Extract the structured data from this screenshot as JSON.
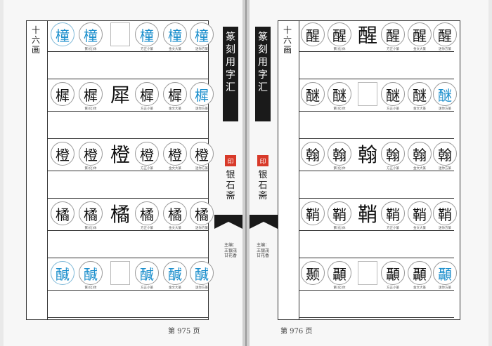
{
  "left_page": {
    "stroke_label": "十六画",
    "page_number": "第 975 页",
    "banner_title": "篆刻用字汇",
    "seal_text": "印",
    "author_name": "银石斋",
    "editor_credit": "主编：王银茂 甘花香",
    "entries": [
      {
        "modern": "橦",
        "traditional": "橦",
        "ancient": "",
        "fangzheng": "橦",
        "jinwen": "橦",
        "miyin": "橦",
        "accent": "blue"
      },
      {
        "modern": "樨",
        "traditional": "樨",
        "ancient": "犀",
        "fangzheng": "樨",
        "jinwen": "樨",
        "miyin": "樨",
        "accent": "mixed"
      },
      {
        "modern": "橙",
        "traditional": "橙",
        "ancient": "橙",
        "fangzheng": "橙",
        "jinwen": "橙",
        "miyin": "橙",
        "accent": "black"
      },
      {
        "modern": "橘",
        "traditional": "橘",
        "ancient": "橘",
        "fangzheng": "橘",
        "jinwen": "橘",
        "miyin": "橘",
        "accent": "black"
      },
      {
        "modern": "醎",
        "traditional": "醎",
        "ancient": "",
        "fangzheng": "醎",
        "jinwen": "醎",
        "miyin": "醎",
        "accent": "blue"
      }
    ]
  },
  "right_page": {
    "stroke_label": "十六画",
    "page_number": "第 976 页",
    "banner_title": "篆刻用字汇",
    "seal_text": "印",
    "author_name": "银石斋",
    "editor_credit": "主编：王银茂 甘花香",
    "entries": [
      {
        "modern": "醒",
        "traditional": "醒",
        "ancient": "醒",
        "fangzheng": "醒",
        "jinwen": "醒",
        "miyin": "醒",
        "accent": "black"
      },
      {
        "modern": "醚",
        "traditional": "醚",
        "ancient": "",
        "fangzheng": "醚",
        "jinwen": "醚",
        "miyin": "醚",
        "accent": "mixed"
      },
      {
        "modern": "翰",
        "traditional": "翰",
        "ancient": "翰",
        "fangzheng": "翰",
        "jinwen": "翰",
        "miyin": "翰",
        "accent": "black"
      },
      {
        "modern": "鞘",
        "traditional": "鞘",
        "ancient": "鞘",
        "fangzheng": "鞘",
        "jinwen": "鞘",
        "miyin": "鞘",
        "accent": "black"
      },
      {
        "modern": "颞",
        "traditional": "顳",
        "ancient": "",
        "fangzheng": "顳",
        "jinwen": "顳",
        "miyin": "顳",
        "accent": "mixed"
      }
    ]
  },
  "captions": {
    "traditional": "繁(化)体",
    "fangzheng": "方正小篆",
    "jinwen": "金文大篆",
    "miyin": "迷你方篆"
  },
  "colors": {
    "accent_blue": "#1a8ecc",
    "seal_red": "#d83a2a",
    "banner_black": "#1a1a1a"
  }
}
